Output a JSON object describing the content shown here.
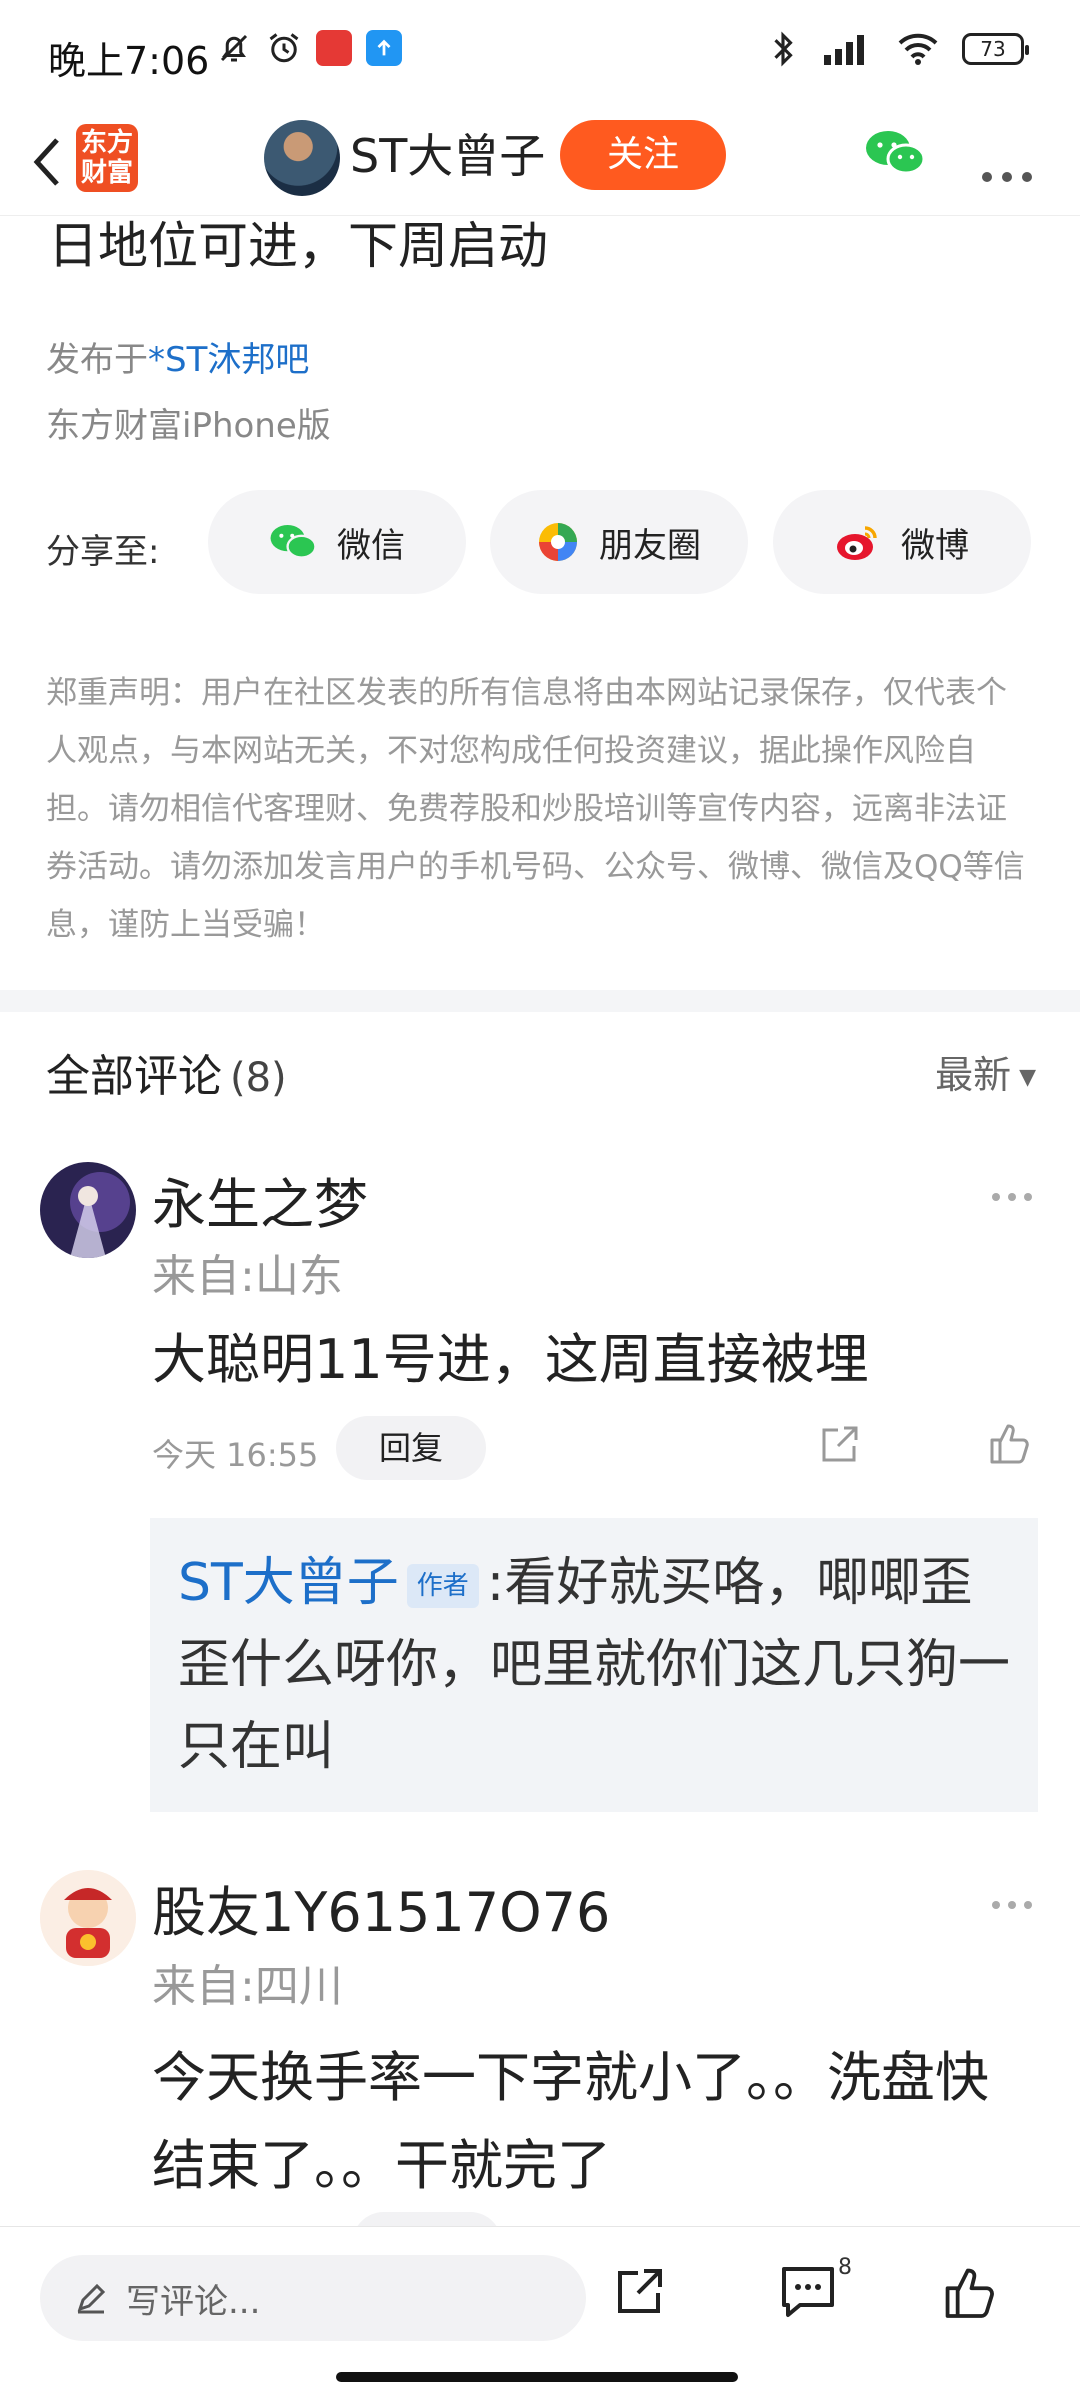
{
  "status_bar": {
    "time": "晚上7:06",
    "battery": "73",
    "icons": [
      "bell-off-icon",
      "alarm-icon",
      "app-red-icon",
      "app-blue-upload-icon",
      "bluetooth-icon",
      "signal-icon",
      "wifi-icon"
    ]
  },
  "nav": {
    "logo_text_line1": "东方",
    "logo_text_line2": "财富",
    "author_name": "ST大曾子",
    "follow_label": "关注"
  },
  "post": {
    "title_cut": "日地位可进，下周启动",
    "published_prefix": "发布于",
    "bar_name": "*ST沐邦吧",
    "device": "东方财富iPhone版"
  },
  "share": {
    "label": "分享至:",
    "buttons": [
      {
        "label": "微信",
        "icon": "wechat-icon"
      },
      {
        "label": "朋友圈",
        "icon": "moments-icon"
      },
      {
        "label": "微博",
        "icon": "weibo-icon"
      }
    ]
  },
  "disclaimer": "郑重声明：用户在社区发表的所有信息将由本网站记录保存，仅代表个人观点，与本网站无关，不对您构成任何投资建议，据此操作风险自担。请勿相信代客理财、免费荐股和炒股培训等宣传内容，远离非法证券活动。请勿添加发言用户的手机号码、公众号、微博、微信及QQ等信息，谨防上当受骗！",
  "comments_header": {
    "title": "全部评论",
    "count": "(8)",
    "sort": "最新"
  },
  "comments": [
    {
      "name": "永生之梦",
      "location": "来自:山东",
      "text": "大聪明11号进，这周直接被埋",
      "time": "今天 16:55",
      "reply_label": "回复",
      "reply": {
        "author": "ST大曾子",
        "badge": "作者",
        "text": ":看好就买咯，唧唧歪歪什么呀你，吧里就你们这几只狗一只在叫"
      }
    },
    {
      "name": "股友1Y61517O76",
      "location": "来自:四川",
      "text": "今天换手率一下字就小了。。洗盘快结束了。。干就完了",
      "reply_label": "回复"
    }
  ],
  "bottom_bar": {
    "input_placeholder": "写评论...",
    "comment_count": "8"
  },
  "colors": {
    "accent_orange": "#ff5a1f",
    "link_blue": "#1d6fc9",
    "muted_gray": "#999999"
  }
}
